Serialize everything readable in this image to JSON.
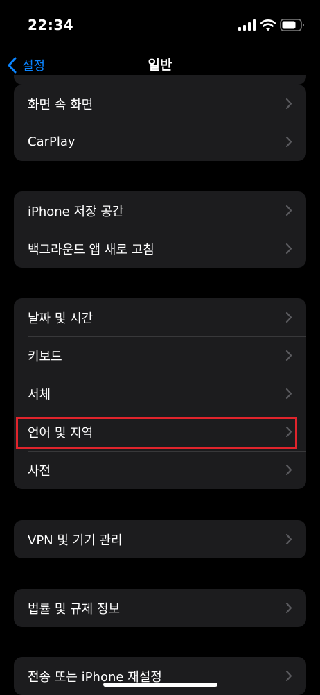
{
  "status": {
    "time": "22:34"
  },
  "nav": {
    "back_label": "설정",
    "title": "일반"
  },
  "groups": [
    {
      "items": [
        {
          "label": "화면 속 화면"
        },
        {
          "label": "CarPlay"
        }
      ]
    },
    {
      "items": [
        {
          "label": "iPhone 저장 공간"
        },
        {
          "label": "백그라운드 앱 새로 고침"
        }
      ]
    },
    {
      "items": [
        {
          "label": "날짜 및 시간"
        },
        {
          "label": "키보드"
        },
        {
          "label": "서체"
        },
        {
          "label": "언어 및 지역",
          "highlighted": true
        },
        {
          "label": "사전"
        }
      ]
    },
    {
      "items": [
        {
          "label": "VPN 및 기기 관리"
        }
      ]
    },
    {
      "items": [
        {
          "label": "법률 및 규제 정보"
        }
      ]
    },
    {
      "items": [
        {
          "label": "전송 또는 iPhone 재설정"
        }
      ]
    }
  ],
  "colors": {
    "accent": "#0a84ff",
    "highlight_box": "#e0242c",
    "cell_bg": "#1c1c1e",
    "page_bg": "#000000"
  }
}
